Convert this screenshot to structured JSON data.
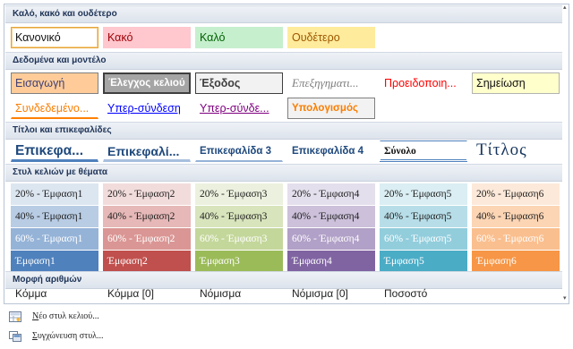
{
  "sections": {
    "good_bad_neutral": "Καλό, κακό και ουδέτερο",
    "data_model": "Δεδομένα και μοντέλο",
    "titles": "Τίτλοι και επικεφαλίδες",
    "themed": "Στυλ κελιών με θέματα",
    "number_format": "Μορφή αριθμών"
  },
  "good_bad_neutral": [
    "Κανονικό",
    "Κακό",
    "Καλό",
    "Ουδέτερο"
  ],
  "data_model_row1": [
    "Εισαγωγή",
    "Έλεγχος κελιού",
    "Έξοδος",
    "Επεξηγηματι...",
    "Προειδοποιη...",
    "Σημείωση"
  ],
  "data_model_row2": [
    "Συνδεδεμένο...",
    "Υπερ-σύνδεση",
    "Υπερ-σύνδε...",
    "Υπολογισμός"
  ],
  "titles": [
    "Επικεφα...",
    "Επικεφαλί...",
    "Επικεφαλίδα 3",
    "Επικεφαλίδα 4",
    "Σύνολο",
    "Τίτλος"
  ],
  "themed_20": [
    "20% - Έμφαση1",
    "20% - Έμφαση2",
    "20% - Έμφαση3",
    "20% - Έμφαση4",
    "20% - Έμφαση5",
    "20% - Έμφαση6"
  ],
  "themed_40": [
    "40% - Έμφαση1",
    "40% - Έμφαση2",
    "40% - Έμφαση3",
    "40% - Έμφαση4",
    "40% - Έμφαση5",
    "40% - Έμφαση6"
  ],
  "themed_60": [
    "60% - Έμφαση1",
    "60% - Έμφαση2",
    "60% - Έμφαση3",
    "60% - Έμφαση4",
    "60% - Έμφαση5",
    "60% - Έμφαση6"
  ],
  "themed_accent": [
    "Έμφαση1",
    "Έμφαση2",
    "Έμφαση3",
    "Έμφαση4",
    "Έμφαση5",
    "Έμφαση6"
  ],
  "number_format": [
    "Κόμμα",
    "Κόμμα [0]",
    "Νόμισμα",
    "Νόμισμα [0]",
    "Ποσοστό"
  ],
  "menu": {
    "new_style_accel": "Ν",
    "new_style_rest": "έο στυλ κελιού...",
    "merge_styles_accel": "Σ",
    "merge_styles_rest": "υγχώνευση στυλ..."
  },
  "icons": {
    "new_style": "new-cell-style-icon",
    "merge_styles": "merge-styles-icon",
    "scroll_up": "scroll-up-icon",
    "scroll_down": "scroll-down-icon"
  },
  "colors": {
    "bad": "#ffc7ce",
    "good": "#c6efce",
    "neutral": "#ffeb9c",
    "accent1": "#4f81bd",
    "accent2": "#c0504d",
    "accent3": "#9bbb59",
    "accent4": "#8064a2",
    "accent5": "#4bacc6",
    "accent6": "#f79646"
  }
}
